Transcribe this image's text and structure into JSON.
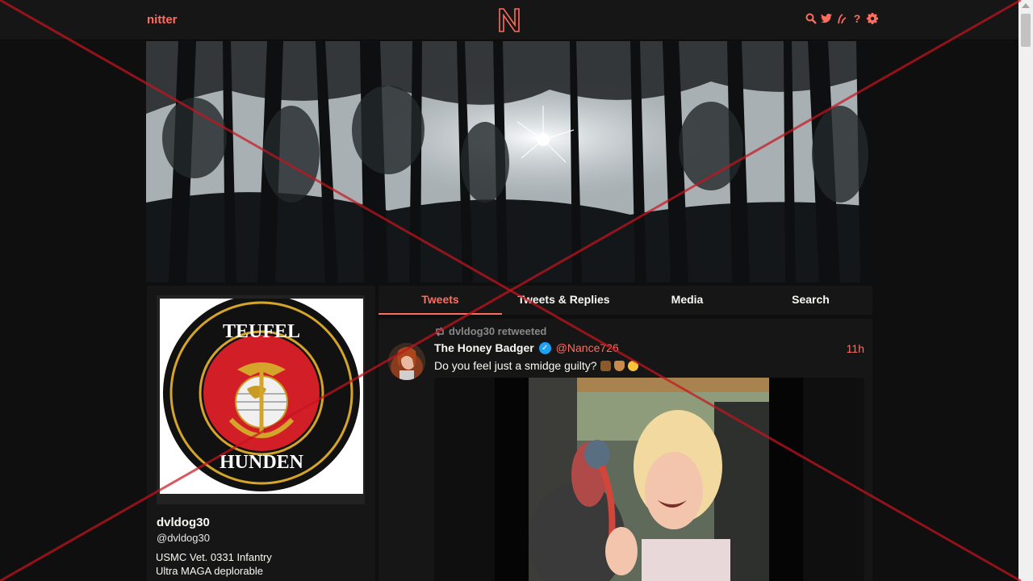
{
  "nav": {
    "brand": "nitter",
    "icons": [
      "search-icon",
      "twitter-bird-icon",
      "rss-icon",
      "help-icon",
      "settings-icon"
    ],
    "help_label": "?"
  },
  "profile": {
    "fullname": "dvldog30",
    "username": "@dvldog30",
    "bio_lines": [
      "USMC Vet. 0331 Infantry",
      "Ultra MAGA deplorable"
    ],
    "avatar_text_top": "TEUFEL",
    "avatar_text_bottom": "HUNDEN"
  },
  "tabs": [
    {
      "label": "Tweets",
      "active": true
    },
    {
      "label": "Tweets & Replies",
      "active": false
    },
    {
      "label": "Media",
      "active": false
    },
    {
      "label": "Search",
      "active": false
    }
  ],
  "tweet": {
    "retweet_label": "dvldog30 retweeted",
    "fullname": "The Honey Badger",
    "username": "@Nance726",
    "date": "11h",
    "text": "Do you feel just a smidge guilty?",
    "emojis": [
      "turkey",
      "heart",
      "grin"
    ]
  },
  "colors": {
    "accent": "#ff6c60",
    "bg": "#0f0f0f",
    "panel": "#161616",
    "text": "#f8f8f2",
    "muted": "#888889",
    "overlay_x": "#c8141e"
  }
}
